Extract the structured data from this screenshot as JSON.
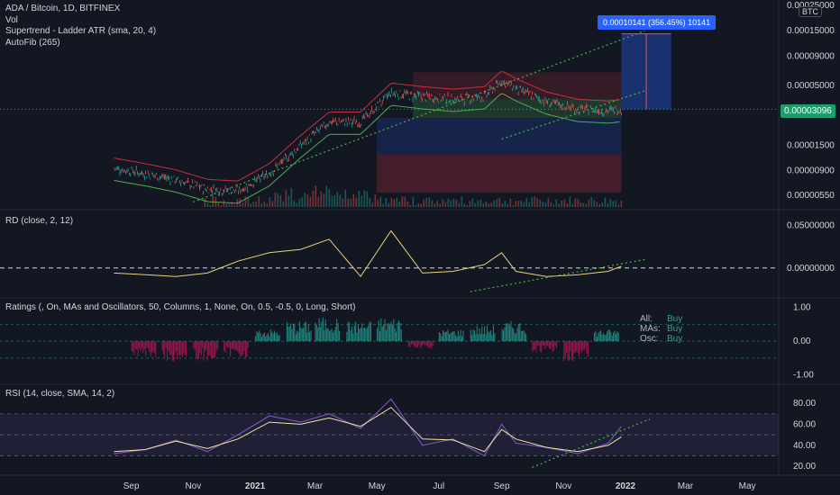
{
  "legend": {
    "title": "ADA / Bitcoin, 1D, BITFINEX",
    "line2": "Vol",
    "line3": "Supertrend - Ladder ATR (sma, 20, 4)",
    "line4": "AutoFib (265)"
  },
  "currency": "BTC",
  "badges": {
    "measure": "0.00010141 (356.45%) 10141",
    "last_price": "0.00003096"
  },
  "panes": {
    "rd_title": "RD (close, 2, 12)",
    "ratings_title": "Ratings (, On, MAs and Oscillators, 50, Columns, 1, None, On, 0.5, -0.5, 0, Long, Short)",
    "rsi_title": "RSI (14, close, SMA, 14, 2)"
  },
  "ratings_table": [
    {
      "label": "All:",
      "value": "Buy"
    },
    {
      "label": "MAs:",
      "value": "Buy"
    },
    {
      "label": "Osc:",
      "value": "Buy"
    }
  ],
  "axes": {
    "price_ticks": [
      "0.00025000",
      "0.00015000",
      "0.00009000",
      "0.00005000",
      "0.00001500",
      "0.00000900",
      "0.00000550"
    ],
    "rd_ticks": [
      "0.05000000",
      "0.00000000"
    ],
    "ratings_ticks": [
      "1.00",
      "0.00",
      "-1.00"
    ],
    "rsi_ticks": [
      "80.00",
      "60.00",
      "40.00",
      "20.00"
    ],
    "time_ticks": [
      "Sep",
      "Nov",
      "2021",
      "Mar",
      "May",
      "Jul",
      "Sep",
      "Nov",
      "2022",
      "Mar",
      "May"
    ]
  },
  "colors": {
    "background": "#131722",
    "up": "#26a69a",
    "down": "#ef5350",
    "supertrend_up": "#4caf50",
    "supertrend_down": "#f23645",
    "trendline": "#4caf50",
    "rd_line": "#e8d37a",
    "rsi_line": "#7e57c2",
    "rsi_ma": "#f0e6a0",
    "measure": "#2962ff"
  },
  "chart_data": [
    {
      "type": "line",
      "title": "ADA / Bitcoin, 1D, BITFINEX",
      "scale": "log",
      "series": [
        {
          "name": "ADA / Bitcoin",
          "x": [
            "2020-08-15",
            "2020-09-15",
            "2020-10-15",
            "2020-11-15",
            "2020-12-15",
            "2021-01-15",
            "2021-02-15",
            "2021-03-15",
            "2021-04-15",
            "2021-05-15",
            "2021-06-15",
            "2021-07-15",
            "2021-08-15",
            "2021-09-01",
            "2021-09-15",
            "2021-10-15",
            "2021-11-15",
            "2021-12-15",
            "2021-12-28"
          ],
          "values": [
            9.5e-06,
            8.5e-06,
            7.5e-06,
            6.2e-06,
            6e-06,
            8.5e-06,
            1.5e-05,
            2.4e-05,
            2.4e-05,
            4.3e-05,
            4e-05,
            3.8e-05,
            4e-05,
            5.5e-05,
            4.7e-05,
            3.6e-05,
            3.1e-05,
            3e-05,
            3.096e-05
          ]
        }
      ]
    },
    {
      "type": "line",
      "title": "RD (close, 2, 12)",
      "ylim": [
        -0.03,
        0.05
      ],
      "series": [
        {
          "name": "RD",
          "x": [
            "2020-08-15",
            "2020-09-15",
            "2020-10-15",
            "2020-11-15",
            "2020-12-15",
            "2021-01-15",
            "2021-02-15",
            "2021-03-15",
            "2021-04-15",
            "2021-05-15",
            "2021-06-15",
            "2021-07-15",
            "2021-08-15",
            "2021-09-01",
            "2021-09-15",
            "2021-10-15",
            "2021-11-15",
            "2021-12-15",
            "2021-12-28"
          ],
          "values": [
            -0.006,
            -0.008,
            -0.01,
            -0.006,
            0.008,
            0.018,
            0.022,
            0.034,
            -0.01,
            0.044,
            -0.006,
            -0.004,
            0.004,
            0.018,
            -0.004,
            -0.01,
            -0.008,
            -0.004,
            0.002
          ]
        }
      ]
    },
    {
      "type": "bar",
      "title": "Ratings (, On, MAs and Oscillators, 50, Columns, 1, None, On, 0.5, -0.5, 0, Long, Short)",
      "ylim": [
        -1,
        1
      ],
      "categories": [
        "2020-09",
        "2020-10",
        "2020-11",
        "2020-12",
        "2021-01",
        "2021-02",
        "2021-03",
        "2021-04",
        "2021-05",
        "2021-06",
        "2021-07",
        "2021-08",
        "2021-09",
        "2021-10",
        "2021-11",
        "2021-12"
      ],
      "values": [
        -0.4,
        -0.5,
        -0.5,
        -0.4,
        0.3,
        0.5,
        0.6,
        0.5,
        0.6,
        -0.2,
        0.3,
        0.4,
        0.5,
        -0.3,
        -0.5,
        0.3
      ]
    },
    {
      "type": "line",
      "title": "RSI (14, close, SMA, 14, 2)",
      "ylim": [
        20,
        90
      ],
      "series": [
        {
          "name": "RSI",
          "x": [
            "2020-08-15",
            "2020-09-15",
            "2020-10-15",
            "2020-11-15",
            "2020-12-15",
            "2021-01-15",
            "2021-02-15",
            "2021-03-15",
            "2021-04-15",
            "2021-05-15",
            "2021-06-15",
            "2021-07-15",
            "2021-08-15",
            "2021-09-01",
            "2021-09-15",
            "2021-10-15",
            "2021-11-15",
            "2021-12-15",
            "2021-12-28"
          ],
          "values": [
            32,
            36,
            45,
            34,
            50,
            68,
            62,
            70,
            56,
            84,
            40,
            46,
            30,
            60,
            42,
            38,
            32,
            42,
            58
          ]
        },
        {
          "name": "RSI-based MA",
          "x": [
            "2020-08-15",
            "2020-09-15",
            "2020-10-15",
            "2020-11-15",
            "2020-12-15",
            "2021-01-15",
            "2021-02-15",
            "2021-03-15",
            "2021-04-15",
            "2021-05-15",
            "2021-06-15",
            "2021-07-15",
            "2021-08-15",
            "2021-09-01",
            "2021-09-15",
            "2021-10-15",
            "2021-11-15",
            "2021-12-15",
            "2021-12-28"
          ],
          "values": [
            34,
            36,
            44,
            37,
            46,
            62,
            60,
            66,
            58,
            76,
            46,
            45,
            34,
            55,
            46,
            38,
            34,
            40,
            48
          ]
        }
      ]
    }
  ]
}
